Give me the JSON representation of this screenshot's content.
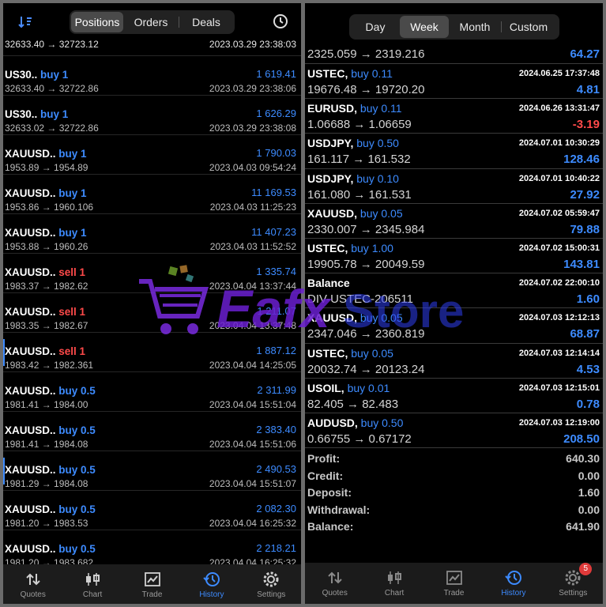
{
  "left": {
    "tabs": [
      "Positions",
      "Orders",
      "Deals"
    ],
    "active_tab": "Positions",
    "first_row": {
      "prices": "32633.40 → 32723.12",
      "time": "2023.03.29 23:38:03"
    },
    "rows": [
      {
        "symbol": "US30..",
        "dir": "buy 1",
        "side": "buy",
        "profit": "1 619.41",
        "prices": "32633.40 → 32722.86",
        "time": "2023.03.29 23:38:06"
      },
      {
        "symbol": "US30..",
        "dir": "buy 1",
        "side": "buy",
        "profit": "1 626.29",
        "prices": "32633.02 → 32722.86",
        "time": "2023.03.29 23:38:08"
      },
      {
        "symbol": "XAUUSD..",
        "dir": "buy 1",
        "side": "buy",
        "profit": "1 790.03",
        "prices": "1953.89 → 1954.89",
        "time": "2023.04.03 09:54:24"
      },
      {
        "symbol": "XAUUSD..",
        "dir": "buy 1",
        "side": "buy",
        "profit": "11 169.53",
        "prices": "1953.86 → 1960.106",
        "time": "2023.04.03 11:25:23"
      },
      {
        "symbol": "XAUUSD..",
        "dir": "buy 1",
        "side": "buy",
        "profit": "11 407.23",
        "prices": "1953.88 → 1960.26",
        "time": "2023.04.03 11:52:52"
      },
      {
        "symbol": "XAUUSD..",
        "dir": "sell 1",
        "side": "sell",
        "profit": "1 335.74",
        "prices": "1983.37 → 1982.62",
        "time": "2023.04.04 13:37:44"
      },
      {
        "symbol": "XAUUSD..",
        "dir": "sell 1",
        "side": "sell",
        "profit": "1 211.07",
        "prices": "1983.35 → 1982.67",
        "time": "2023.04.04 13:37:48"
      },
      {
        "symbol": "XAUUSD..",
        "dir": "sell 1",
        "side": "sell",
        "profit": "1 887.12",
        "prices": "1983.42 → 1982.361",
        "time": "2023.04.04 14:25:05"
      },
      {
        "symbol": "XAUUSD..",
        "dir": "buy 0.5",
        "side": "buy",
        "profit": "2 311.99",
        "prices": "1981.41 → 1984.00",
        "time": "2023.04.04 15:51:04"
      },
      {
        "symbol": "XAUUSD..",
        "dir": "buy 0.5",
        "side": "buy",
        "profit": "2 383.40",
        "prices": "1981.41 → 1984.08",
        "time": "2023.04.04 15:51:06"
      },
      {
        "symbol": "XAUUSD..",
        "dir": "buy 0.5",
        "side": "buy",
        "profit": "2 490.53",
        "prices": "1981.29 → 1984.08",
        "time": "2023.04.04 15:51:07"
      },
      {
        "symbol": "XAUUSD..",
        "dir": "buy 0.5",
        "side": "buy",
        "profit": "2 082.30",
        "prices": "1981.20 → 1983.53",
        "time": "2023.04.04 16:25:32"
      },
      {
        "symbol": "XAUUSD..",
        "dir": "buy 0.5",
        "side": "buy",
        "profit": "2 218.21",
        "prices": "1981.20 → 1983.682",
        "time": "2023.04.04 16:25:32"
      }
    ],
    "nav": [
      "Quotes",
      "Chart",
      "Trade",
      "History",
      "Settings"
    ],
    "active_nav": "History"
  },
  "right": {
    "tabs": [
      "Day",
      "Week",
      "Month",
      "Custom"
    ],
    "active_tab": "Week",
    "first_row": {
      "prices": "2325.059 → 2319.216",
      "profit": "64.27"
    },
    "rows": [
      {
        "symbol": "USTEC,",
        "dir": "buy 0.11",
        "side": "buy",
        "time": "2024.06.25 17:37:48",
        "prices": "19676.48 → 19720.20",
        "profit": "4.81",
        "neg": false
      },
      {
        "symbol": "EURUSD,",
        "dir": "buy 0.11",
        "side": "buy",
        "time": "2024.06.26 13:31:47",
        "prices": "1.06688 → 1.06659",
        "profit": "-3.19",
        "neg": true
      },
      {
        "symbol": "USDJPY,",
        "dir": "buy 0.50",
        "side": "buy",
        "time": "2024.07.01 10:30:29",
        "prices": "161.117 → 161.532",
        "profit": "128.46",
        "neg": false
      },
      {
        "symbol": "USDJPY,",
        "dir": "buy 0.10",
        "side": "buy",
        "time": "2024.07.01 10:40:22",
        "prices": "161.080 → 161.531",
        "profit": "27.92",
        "neg": false
      },
      {
        "symbol": "XAUUSD,",
        "dir": "buy 0.05",
        "side": "buy",
        "time": "2024.07.02 05:59:47",
        "prices": "2330.007 → 2345.984",
        "profit": "79.88",
        "neg": false
      },
      {
        "symbol": "USTEC,",
        "dir": "buy 1.00",
        "side": "buy",
        "time": "2024.07.02 15:00:31",
        "prices": "19905.78 → 20049.59",
        "profit": "143.81",
        "neg": false
      },
      {
        "symbol": "Balance",
        "dir": "",
        "side": "buy",
        "time": "2024.07.02 22:00:10",
        "prices": "DIV-USTEC-206511",
        "profit": "1.60",
        "neg": false
      },
      {
        "symbol": "XAUUSD,",
        "dir": "buy 0.05",
        "side": "buy",
        "time": "2024.07.03 12:12:13",
        "prices": "2347.046 → 2360.819",
        "profit": "68.87",
        "neg": false
      },
      {
        "symbol": "USTEC,",
        "dir": "buy 0.05",
        "side": "buy",
        "time": "2024.07.03 12:14:14",
        "prices": "20032.74 → 20123.24",
        "profit": "4.53",
        "neg": false
      },
      {
        "symbol": "USOIL,",
        "dir": "buy 0.01",
        "side": "buy",
        "time": "2024.07.03 12:15:01",
        "prices": "82.405 → 82.483",
        "profit": "0.78",
        "neg": false
      },
      {
        "symbol": "AUDUSD,",
        "dir": "buy 0.50",
        "side": "buy",
        "time": "2024.07.03 12:19:00",
        "prices": "0.66755 → 0.67172",
        "profit": "208.50",
        "neg": false
      }
    ],
    "summary": [
      {
        "k": "Profit:",
        "v": "640.30"
      },
      {
        "k": "Credit:",
        "v": "0.00"
      },
      {
        "k": "Deposit:",
        "v": "1.60"
      },
      {
        "k": "Withdrawal:",
        "v": "0.00"
      },
      {
        "k": "Balance:",
        "v": "641.90"
      }
    ],
    "nav": [
      "Quotes",
      "Chart",
      "Trade",
      "History",
      "Settings"
    ],
    "active_nav": "History",
    "settings_badge": "5"
  },
  "watermark": {
    "text": "EafxStore",
    "colors": {
      "purple": "#6a1fd0",
      "blue": "#2f3ff0"
    }
  },
  "colors": {
    "accent": "#3d8bff",
    "sell": "#ff4a4a",
    "background": "#000000"
  }
}
